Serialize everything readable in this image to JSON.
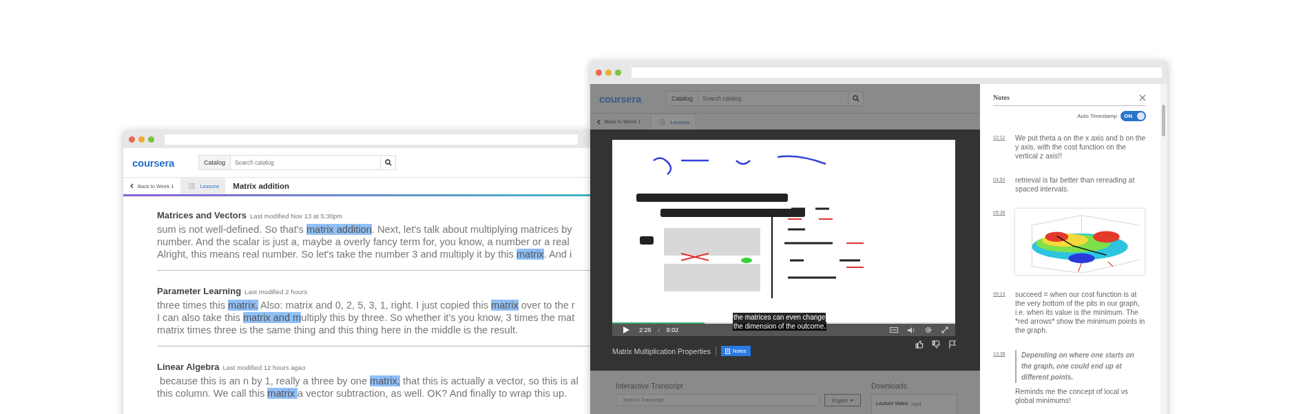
{
  "back_window": {
    "header": {
      "logo": "coursera",
      "catalog": "Catalog",
      "search_placeholder": "Search catalog"
    },
    "nav": {
      "back": "Back to Week 1",
      "lessons": "Lessons",
      "title": "Matrix addition"
    },
    "sections": [
      {
        "title": "Matrices and Vectors",
        "modified": "Last modified Nov 13 at 5:30pm",
        "lines": [
          [
            {
              "text": "sum is not well-defined. So that's ",
              "highlighted": false
            },
            {
              "text": "matrix addition",
              "highlighted": true
            },
            {
              "text": ". Next, let's talk about multiplying matrices by",
              "highlighted": false
            }
          ],
          [
            {
              "text": "number. And the scalar is just a, maybe a overly fancy term for, you know, a number or a real",
              "highlighted": false
            }
          ],
          [
            {
              "text": "Alright, this means real number. So let's take the number 3 and multiply it by this ",
              "highlighted": false
            },
            {
              "text": "matrix",
              "highlighted": true
            },
            {
              "text": ". And i",
              "highlighted": false
            }
          ]
        ]
      },
      {
        "title": "Parameter Learning",
        "modified": "Last modified 2 hours",
        "lines": [
          [
            {
              "text": "three times this ",
              "highlighted": false
            },
            {
              "text": "matrix.",
              "highlighted": true
            },
            {
              "text": " Also: matrix and 0, 2, 5, 3, 1, right. I just copied this ",
              "highlighted": false
            },
            {
              "text": "matrix",
              "highlighted": true
            },
            {
              "text": " over to the r",
              "highlighted": false
            }
          ],
          [
            {
              "text": "I can also take this ",
              "highlighted": false
            },
            {
              "text": "matrix and m",
              "highlighted": true
            },
            {
              "text": "ultiply this by three. So whether it's you know, 3 times the mat",
              "highlighted": false
            }
          ],
          [
            {
              "text": "matrix times three is the same thing and this thing here in the middle is the result.",
              "highlighted": false
            }
          ]
        ]
      },
      {
        "title": "Linear Algebra",
        "modified": "Last modified 12 hours agao",
        "lines": [
          [
            {
              "text": " because this is an n by 1, really a three by one ",
              "highlighted": false
            },
            {
              "text": "matrix,",
              "highlighted": true
            },
            {
              "text": " that this is actually a vector, so this is al",
              "highlighted": false
            }
          ],
          [
            {
              "text": "this column. We call this ",
              "highlighted": false
            },
            {
              "text": "matrix ",
              "highlighted": true
            },
            {
              "text": "a vector subtraction, as well. OK? And finally to wrap this up.",
              "highlighted": false
            }
          ]
        ]
      }
    ]
  },
  "front_window": {
    "header": {
      "logo": "coursera",
      "catalog": "Catalog",
      "search_placeholder": "Search catalog"
    },
    "nav": {
      "back": "Back to Week 1",
      "lessons": "Lessons"
    },
    "video": {
      "captions": [
        "the matrices can even change",
        "the dimension of the outcome."
      ],
      "current_time": "2:26",
      "separator": "/",
      "duration": "9:02",
      "level": 0.27
    },
    "lecture": {
      "title": "Matrix Multiplication Properties",
      "notes_button": "Notes"
    },
    "transcript": {
      "heading": "Interactive Transcript",
      "search_placeholder": "Search Transcript",
      "language": "English"
    },
    "downloads": {
      "heading": "Downloads",
      "items": [
        {
          "name": "Lecture Video",
          "format": "mp4"
        }
      ]
    },
    "notes_panel": {
      "title": "Notes",
      "auto_timestamp": {
        "label": "Auto Timestamp",
        "on": true,
        "state_text": "ON"
      },
      "notes": [
        {
          "kind": "text",
          "time": "02:12",
          "text": "We put theta a on the x axis and b on the y axis, with the cost function on the vertical z axis!!"
        },
        {
          "kind": "text",
          "time": "04:54",
          "text": "retrieval is far better than rereading at spaced intervals."
        },
        {
          "time": "05:38"
        },
        {
          "kind": "text",
          "time": "06:13",
          "text": "succeed = when our cost function is at the very bottom of the pits in our graph, i.e. when its value is the minimum. The *red arrows* show the minimum points in the graph."
        },
        {
          "kind": "quote",
          "time": "13:38",
          "quote": "Depending on where one starts on the graph, one could end up at different points.",
          "text": "Reminds me the concept of local vs global minimums!"
        }
      ]
    }
  }
}
